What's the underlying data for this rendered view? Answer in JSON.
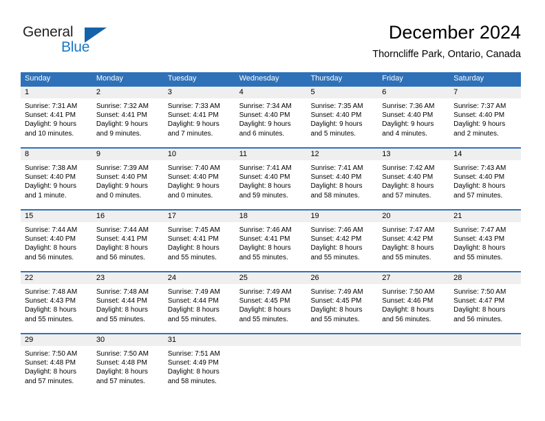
{
  "brand": {
    "name_top": "General",
    "name_bottom": "Blue",
    "accent_color": "#1878c8",
    "triangle_color": "#1463a8"
  },
  "header": {
    "month_title": "December 2024",
    "location": "Thorncliffe Park, Ontario, Canada"
  },
  "calendar": {
    "header_color": "#2E71B8",
    "day_band_color": "#efefef",
    "weekdays": [
      "Sunday",
      "Monday",
      "Tuesday",
      "Wednesday",
      "Thursday",
      "Friday",
      "Saturday"
    ],
    "weeks": [
      [
        {
          "day": "1",
          "sunrise": "Sunrise: 7:31 AM",
          "sunset": "Sunset: 4:41 PM",
          "daylight_line1": "Daylight: 9 hours",
          "daylight_line2": "and 10 minutes."
        },
        {
          "day": "2",
          "sunrise": "Sunrise: 7:32 AM",
          "sunset": "Sunset: 4:41 PM",
          "daylight_line1": "Daylight: 9 hours",
          "daylight_line2": "and 9 minutes."
        },
        {
          "day": "3",
          "sunrise": "Sunrise: 7:33 AM",
          "sunset": "Sunset: 4:41 PM",
          "daylight_line1": "Daylight: 9 hours",
          "daylight_line2": "and 7 minutes."
        },
        {
          "day": "4",
          "sunrise": "Sunrise: 7:34 AM",
          "sunset": "Sunset: 4:40 PM",
          "daylight_line1": "Daylight: 9 hours",
          "daylight_line2": "and 6 minutes."
        },
        {
          "day": "5",
          "sunrise": "Sunrise: 7:35 AM",
          "sunset": "Sunset: 4:40 PM",
          "daylight_line1": "Daylight: 9 hours",
          "daylight_line2": "and 5 minutes."
        },
        {
          "day": "6",
          "sunrise": "Sunrise: 7:36 AM",
          "sunset": "Sunset: 4:40 PM",
          "daylight_line1": "Daylight: 9 hours",
          "daylight_line2": "and 4 minutes."
        },
        {
          "day": "7",
          "sunrise": "Sunrise: 7:37 AM",
          "sunset": "Sunset: 4:40 PM",
          "daylight_line1": "Daylight: 9 hours",
          "daylight_line2": "and 2 minutes."
        }
      ],
      [
        {
          "day": "8",
          "sunrise": "Sunrise: 7:38 AM",
          "sunset": "Sunset: 4:40 PM",
          "daylight_line1": "Daylight: 9 hours",
          "daylight_line2": "and 1 minute."
        },
        {
          "day": "9",
          "sunrise": "Sunrise: 7:39 AM",
          "sunset": "Sunset: 4:40 PM",
          "daylight_line1": "Daylight: 9 hours",
          "daylight_line2": "and 0 minutes."
        },
        {
          "day": "10",
          "sunrise": "Sunrise: 7:40 AM",
          "sunset": "Sunset: 4:40 PM",
          "daylight_line1": "Daylight: 9 hours",
          "daylight_line2": "and 0 minutes."
        },
        {
          "day": "11",
          "sunrise": "Sunrise: 7:41 AM",
          "sunset": "Sunset: 4:40 PM",
          "daylight_line1": "Daylight: 8 hours",
          "daylight_line2": "and 59 minutes."
        },
        {
          "day": "12",
          "sunrise": "Sunrise: 7:41 AM",
          "sunset": "Sunset: 4:40 PM",
          "daylight_line1": "Daylight: 8 hours",
          "daylight_line2": "and 58 minutes."
        },
        {
          "day": "13",
          "sunrise": "Sunrise: 7:42 AM",
          "sunset": "Sunset: 4:40 PM",
          "daylight_line1": "Daylight: 8 hours",
          "daylight_line2": "and 57 minutes."
        },
        {
          "day": "14",
          "sunrise": "Sunrise: 7:43 AM",
          "sunset": "Sunset: 4:40 PM",
          "daylight_line1": "Daylight: 8 hours",
          "daylight_line2": "and 57 minutes."
        }
      ],
      [
        {
          "day": "15",
          "sunrise": "Sunrise: 7:44 AM",
          "sunset": "Sunset: 4:40 PM",
          "daylight_line1": "Daylight: 8 hours",
          "daylight_line2": "and 56 minutes."
        },
        {
          "day": "16",
          "sunrise": "Sunrise: 7:44 AM",
          "sunset": "Sunset: 4:41 PM",
          "daylight_line1": "Daylight: 8 hours",
          "daylight_line2": "and 56 minutes."
        },
        {
          "day": "17",
          "sunrise": "Sunrise: 7:45 AM",
          "sunset": "Sunset: 4:41 PM",
          "daylight_line1": "Daylight: 8 hours",
          "daylight_line2": "and 55 minutes."
        },
        {
          "day": "18",
          "sunrise": "Sunrise: 7:46 AM",
          "sunset": "Sunset: 4:41 PM",
          "daylight_line1": "Daylight: 8 hours",
          "daylight_line2": "and 55 minutes."
        },
        {
          "day": "19",
          "sunrise": "Sunrise: 7:46 AM",
          "sunset": "Sunset: 4:42 PM",
          "daylight_line1": "Daylight: 8 hours",
          "daylight_line2": "and 55 minutes."
        },
        {
          "day": "20",
          "sunrise": "Sunrise: 7:47 AM",
          "sunset": "Sunset: 4:42 PM",
          "daylight_line1": "Daylight: 8 hours",
          "daylight_line2": "and 55 minutes."
        },
        {
          "day": "21",
          "sunrise": "Sunrise: 7:47 AM",
          "sunset": "Sunset: 4:43 PM",
          "daylight_line1": "Daylight: 8 hours",
          "daylight_line2": "and 55 minutes."
        }
      ],
      [
        {
          "day": "22",
          "sunrise": "Sunrise: 7:48 AM",
          "sunset": "Sunset: 4:43 PM",
          "daylight_line1": "Daylight: 8 hours",
          "daylight_line2": "and 55 minutes."
        },
        {
          "day": "23",
          "sunrise": "Sunrise: 7:48 AM",
          "sunset": "Sunset: 4:44 PM",
          "daylight_line1": "Daylight: 8 hours",
          "daylight_line2": "and 55 minutes."
        },
        {
          "day": "24",
          "sunrise": "Sunrise: 7:49 AM",
          "sunset": "Sunset: 4:44 PM",
          "daylight_line1": "Daylight: 8 hours",
          "daylight_line2": "and 55 minutes."
        },
        {
          "day": "25",
          "sunrise": "Sunrise: 7:49 AM",
          "sunset": "Sunset: 4:45 PM",
          "daylight_line1": "Daylight: 8 hours",
          "daylight_line2": "and 55 minutes."
        },
        {
          "day": "26",
          "sunrise": "Sunrise: 7:49 AM",
          "sunset": "Sunset: 4:45 PM",
          "daylight_line1": "Daylight: 8 hours",
          "daylight_line2": "and 55 minutes."
        },
        {
          "day": "27",
          "sunrise": "Sunrise: 7:50 AM",
          "sunset": "Sunset: 4:46 PM",
          "daylight_line1": "Daylight: 8 hours",
          "daylight_line2": "and 56 minutes."
        },
        {
          "day": "28",
          "sunrise": "Sunrise: 7:50 AM",
          "sunset": "Sunset: 4:47 PM",
          "daylight_line1": "Daylight: 8 hours",
          "daylight_line2": "and 56 minutes."
        }
      ],
      [
        {
          "day": "29",
          "sunrise": "Sunrise: 7:50 AM",
          "sunset": "Sunset: 4:48 PM",
          "daylight_line1": "Daylight: 8 hours",
          "daylight_line2": "and 57 minutes."
        },
        {
          "day": "30",
          "sunrise": "Sunrise: 7:50 AM",
          "sunset": "Sunset: 4:48 PM",
          "daylight_line1": "Daylight: 8 hours",
          "daylight_line2": "and 57 minutes."
        },
        {
          "day": "31",
          "sunrise": "Sunrise: 7:51 AM",
          "sunset": "Sunset: 4:49 PM",
          "daylight_line1": "Daylight: 8 hours",
          "daylight_line2": "and 58 minutes."
        },
        {
          "day": "",
          "sunrise": "",
          "sunset": "",
          "daylight_line1": "",
          "daylight_line2": ""
        },
        {
          "day": "",
          "sunrise": "",
          "sunset": "",
          "daylight_line1": "",
          "daylight_line2": ""
        },
        {
          "day": "",
          "sunrise": "",
          "sunset": "",
          "daylight_line1": "",
          "daylight_line2": ""
        },
        {
          "day": "",
          "sunrise": "",
          "sunset": "",
          "daylight_line1": "",
          "daylight_line2": ""
        }
      ]
    ]
  }
}
